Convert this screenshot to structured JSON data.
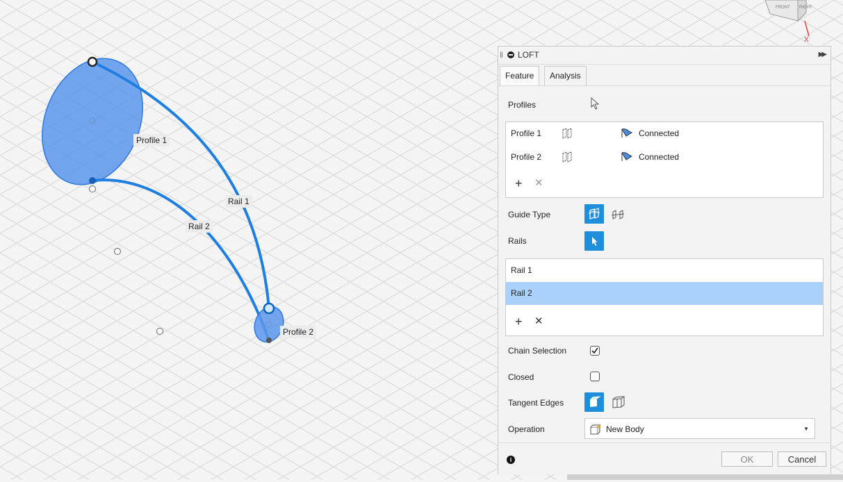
{
  "dialog": {
    "title": "LOFT",
    "tabs": [
      {
        "label": "Feature"
      },
      {
        "label": "Analysis"
      }
    ],
    "profiles_label": "Profiles",
    "profiles": [
      {
        "name": "Profile 1",
        "status": "Connected"
      },
      {
        "name": "Profile 2",
        "status": "Connected"
      }
    ],
    "guide_type_label": "Guide Type",
    "rails_label": "Rails",
    "rails": [
      {
        "name": "Rail 1"
      },
      {
        "name": "Rail 2",
        "selected": true
      }
    ],
    "chain_selection_label": "Chain Selection",
    "chain_selection_checked": true,
    "closed_label": "Closed",
    "closed_checked": false,
    "tangent_edges_label": "Tangent Edges",
    "operation_label": "Operation",
    "operation_value": "New Body",
    "ok_label": "OK",
    "cancel_label": "Cancel"
  },
  "viewport": {
    "labels": {
      "profile1": "Profile 1",
      "profile2": "Profile 2",
      "rail1": "Rail 1",
      "rail2": "Rail 2"
    },
    "viewcube_front": "FRONT",
    "viewcube_right": "RIGHT",
    "axis_x": "X"
  },
  "colors": {
    "accent": "#1f8fdb",
    "profile_fill": "#5c97ec",
    "rail_blue": "#1e7fe0",
    "selection": "#a9d1fb"
  }
}
